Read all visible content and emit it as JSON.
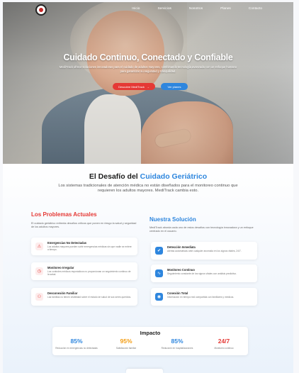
{
  "nav": {
    "links": [
      "Inicio",
      "Servicios",
      "Nosotros",
      "Planes",
      "Contacto"
    ]
  },
  "hero": {
    "title": "Cuidado Continuo, Conectado y Confiable",
    "subtitle": "MediTrack ofrece soluciones innovadoras para el cuidado de adultos mayores, combinando tecnología avanzada con un enfoque humano para garantizar su seguridad y tranquilidad.",
    "primary_button": "Descubre MediTrack",
    "primary_arrow": "→",
    "secondary_button": "Ver planes"
  },
  "challenge": {
    "title_prefix": "El Desafío del ",
    "title_highlight": "Cuidado Geriátrico",
    "description": "Los sistemas tradicionales de atención médica no están diseñados para el monitoreo continuo que requieren los adultos mayores. MediTrack cambia esto."
  },
  "problems": {
    "heading": "Los Problemas Actuales",
    "description": "El cuidado geriátrico enfrenta desafíos críticos que ponen en riesgo la salud y seguridad de los adultos mayores.",
    "items": [
      {
        "icon": "alert-triangle-icon",
        "glyph": "⚠",
        "title": "Emergencias No Detectadas",
        "text": "Los adultos mayores pueden sufrir emergencias médicas sin que nadie se entere a tiempo."
      },
      {
        "icon": "clock-icon",
        "glyph": "◷",
        "title": "Monitoreo Irregular",
        "text": "Los controles médicos esporádicos no proporcionan un seguimiento continuo de la salud."
      },
      {
        "icon": "users-icon",
        "glyph": "⚇",
        "title": "Desconexión Familiar",
        "text": "Las familias no tienen visibilidad sobre el estado de salud de sus seres queridos."
      }
    ]
  },
  "solution": {
    "heading": "Nuestra Solución",
    "description": "MediTrack aborda cada uno de estos desafíos con tecnología innovadora y un enfoque centrado en el usuario.",
    "items": [
      {
        "icon": "shield-check-icon",
        "glyph": "✔",
        "title": "Detección Inmediata",
        "text": "Alertas automáticas ante cualquier anomalía en los signos vitales, 24/7."
      },
      {
        "icon": "activity-icon",
        "glyph": "∿",
        "title": "Monitoreo Continuo",
        "text": "Seguimiento constante de los signos vitales con análisis predictivo."
      },
      {
        "icon": "connection-icon",
        "glyph": "◉",
        "title": "Conexión Total",
        "text": "Información en tiempo real compartida con familiares y médicos."
      }
    ]
  },
  "impact": {
    "title": "Impacto",
    "stats": [
      {
        "value": "85%",
        "label": "Reducción en emergencias no detectadas",
        "color": "#2e86de"
      },
      {
        "value": "95%",
        "label": "Satisfacción familiar",
        "color": "#f39c12"
      },
      {
        "value": "85%",
        "label": "Reducción en hospitalizaciones",
        "color": "#2e86de"
      },
      {
        "value": "24/7",
        "label": "Monitoreo continuo",
        "color": "#e53935"
      }
    ]
  },
  "colors": {
    "accent_red": "#e53935",
    "accent_blue": "#2e86de",
    "accent_orange": "#f39c12"
  }
}
